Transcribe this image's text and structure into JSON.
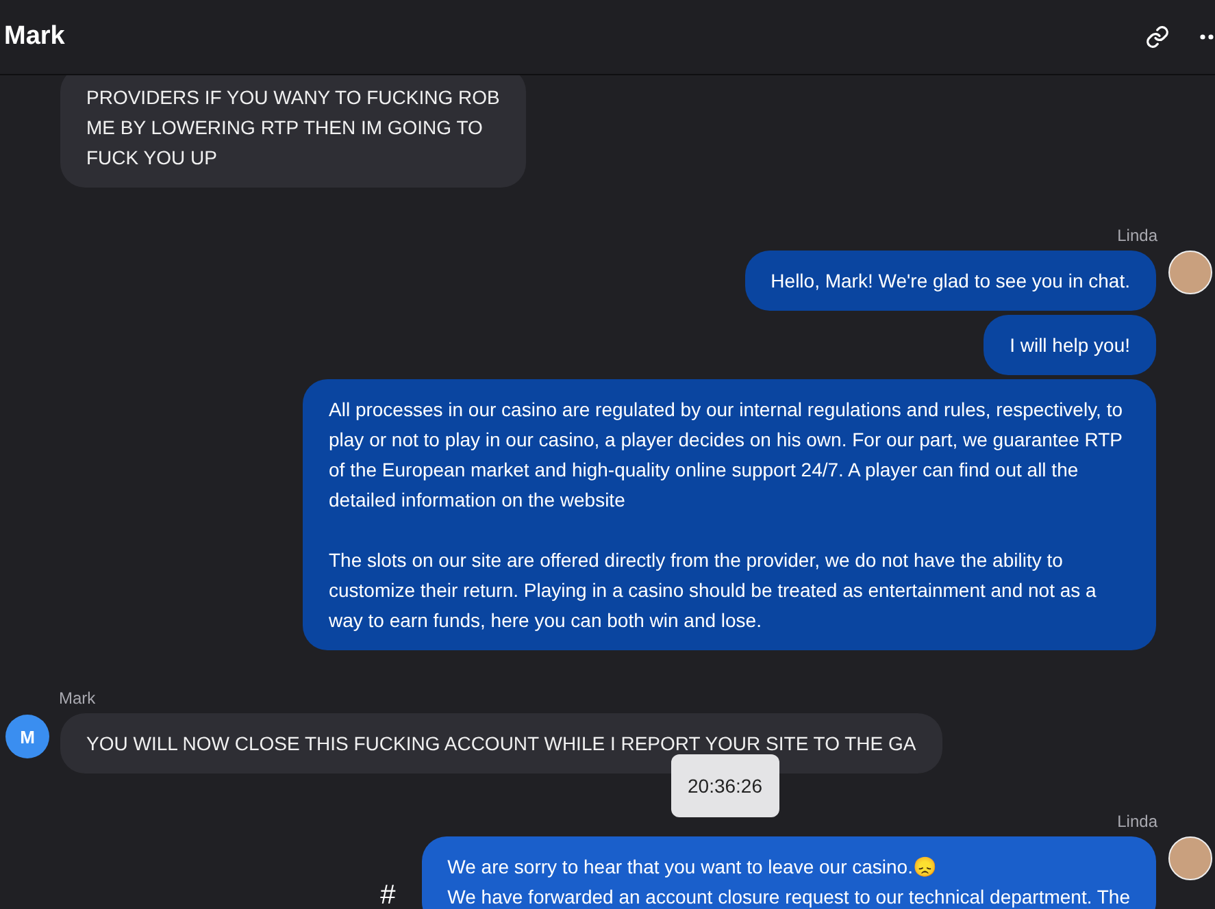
{
  "header": {
    "title": "Mark"
  },
  "messages": [
    {
      "kind": "incoming",
      "text": "PROVIDERS IF YOU WANY TO FUCKING ROB\nME BY LOWERING RTP THEN IM GOING TO\nFUCK YOU UP",
      "highlighted": false
    },
    {
      "kind": "outgoing",
      "sender": "Linda",
      "avatar": {
        "kind": "photo"
      },
      "text": "Hello, Mark! We're glad to see you in chat.",
      "highlighted": false
    },
    {
      "kind": "outgoing",
      "text": "I will help you!",
      "highlighted": false
    },
    {
      "kind": "outgoing",
      "text": "All processes in our casino are regulated by our internal regulations and rules, respectively, to play or not to play in our casino, a player decides on his own. For our part, we guarantee RTP of the European market and high-quality online support 24/7. A player can find out all the detailed information on the website\n\nThe slots on our site are offered directly from the provider, we do not have the ability to customize their return. Playing in a casino should be treated as entertainment and not as a way to earn funds, here you can both win and lose.",
      "highlighted": false
    },
    {
      "kind": "incoming",
      "sender": "Mark",
      "avatar": {
        "kind": "letter",
        "text": "M"
      },
      "text": "YOU WILL NOW CLOSE THIS FUCKING ACCOUNT WHILE I REPORT YOUR SITE TO THE GA",
      "highlighted": false,
      "tooltip": "20:36:26"
    },
    {
      "kind": "outgoing",
      "sender": "Linda",
      "avatar": {
        "kind": "photo"
      },
      "text": "We are sorry to hear that you want to leave our casino.😞\nWe have forwarded an account closure request to our technical department. The",
      "highlighted": true,
      "action": "#"
    }
  ]
}
